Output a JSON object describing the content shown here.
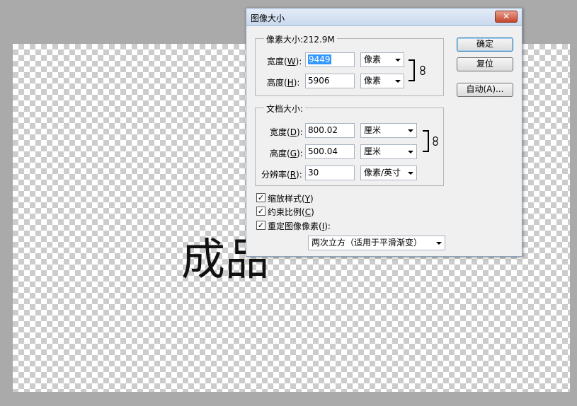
{
  "canvas": {
    "text": "成品"
  },
  "dialog": {
    "title": "图像大小",
    "close_label": "✕",
    "pixel_dimensions": {
      "heading": "像素大小:212.9M",
      "width_label": "宽度(",
      "width_key": "W",
      "width_value": "9449",
      "width_unit": "像素",
      "height_label": "高度(",
      "height_key": "H",
      "height_value": "5906",
      "height_unit": "像素"
    },
    "document_size": {
      "heading": "文档大小:",
      "width_label": "宽度(",
      "width_key": "D",
      "width_value": "800.02",
      "width_unit": "厘米",
      "height_label": "高度(",
      "height_key": "G",
      "height_value": "500.04",
      "height_unit": "厘米",
      "resolution_label": "分辨率(",
      "resolution_key": "R",
      "resolution_value": "30",
      "resolution_unit": "像素/英寸"
    },
    "options": {
      "scale_styles": {
        "label": "缩放样式(",
        "key": "Y",
        "checked": true
      },
      "constrain": {
        "label": "约束比例(",
        "key": "C",
        "checked": true
      },
      "resample": {
        "label": "重定图像像素(",
        "key": "I",
        "checked": true
      },
      "resample_method": "两次立方（适用于平滑渐变）"
    },
    "buttons": {
      "ok": "确定",
      "reset": "复位",
      "auto": "自动(A)..."
    }
  },
  "colors": {
    "selection": "#3399ff",
    "close": "#c6452b"
  }
}
